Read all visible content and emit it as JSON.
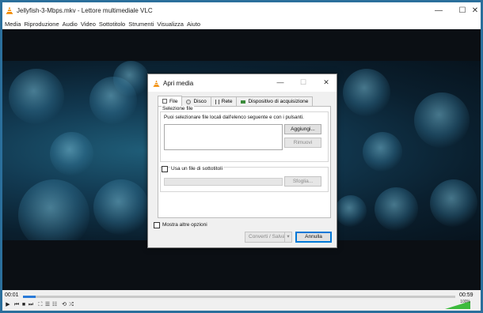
{
  "window": {
    "title": "Jellyfish-3-Mbps.mkv - Lettore multimediale VLC",
    "controls": {
      "minimize": "—",
      "maximize": "☐",
      "close": "✕"
    }
  },
  "menubar": {
    "items": [
      "Media",
      "Riproduzione",
      "Audio",
      "Video",
      "Sottotitolo",
      "Strumenti",
      "Visualizza",
      "Aiuto"
    ]
  },
  "player": {
    "time_elapsed": "00:01",
    "time_total": "00:59",
    "progress_fraction": 0.03,
    "volume_percent": "100%",
    "volume_fraction": 1.0,
    "buttons": {
      "play": "▶",
      "prev": "⏮",
      "stop": "■",
      "next": "⏭",
      "fullscreen": "⛶",
      "ext": "☰",
      "playlist": "☷",
      "loop": "⟲",
      "random": "⤮"
    }
  },
  "dialog": {
    "title": "Apri media",
    "controls": {
      "minimize": "—",
      "maximize": "☐",
      "close": "✕"
    },
    "tabs": [
      {
        "label": "File",
        "icon": "file-icon",
        "active": true
      },
      {
        "label": "Disco",
        "icon": "disc-icon",
        "active": false
      },
      {
        "label": "Rete",
        "icon": "network-icon",
        "active": false
      },
      {
        "label": "Dispositivo di acquisizione",
        "icon": "capture-device-icon",
        "active": false
      }
    ],
    "file_selection": {
      "group_label": "Selezione file",
      "description": "Puoi selezionare file locali dall'elenco seguente e con i pulsanti.",
      "add_button": "Aggiungi...",
      "remove_button": "Rimuovi"
    },
    "subtitles": {
      "checkbox_label": "Usa un file di sottotitoli",
      "checked": false,
      "browse_button": "Sfoglia..."
    },
    "more_options": {
      "label": "Mostra altre opzioni",
      "checked": false
    },
    "convert_button": "Converti / Salva",
    "convert_dropdown": "▾",
    "cancel_button": "Annulla"
  },
  "colors": {
    "accent": "#0078d7",
    "seek_fill": "#2a7ad8",
    "vlc_orange": "#f18a00",
    "volume_green": "#3dbb3d"
  }
}
